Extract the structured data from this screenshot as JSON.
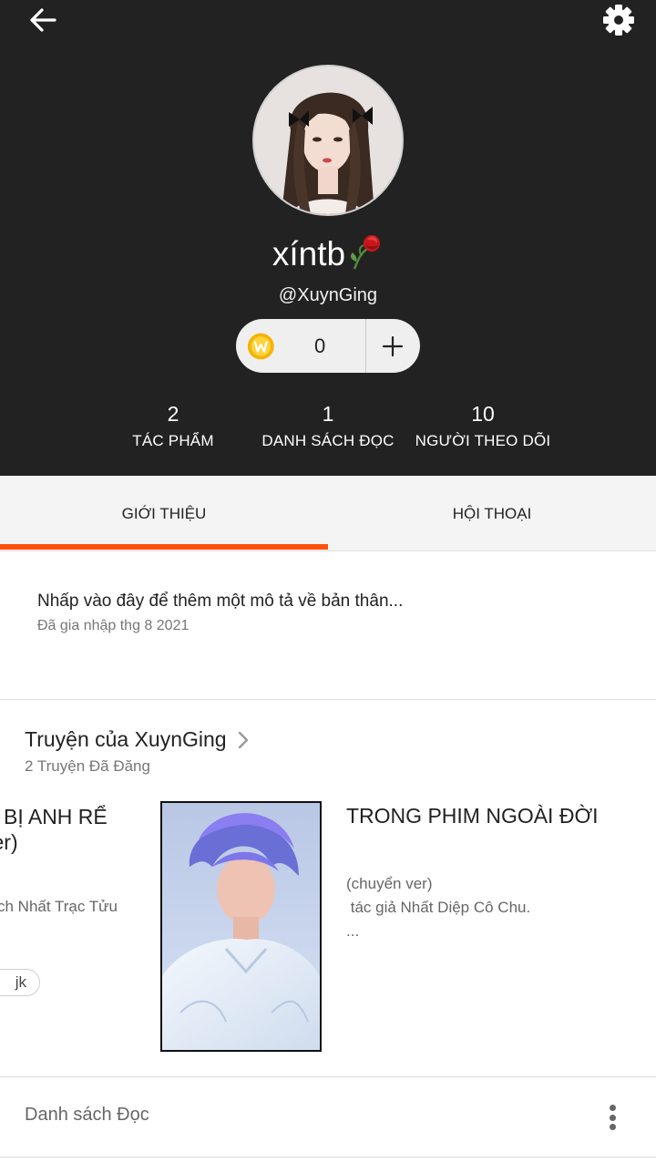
{
  "header": {
    "display_name": "xíntb",
    "username": "@XuynGing",
    "coins": {
      "count": "0",
      "icon": "wattpad-coin-icon",
      "add_icon": "plus-icon"
    },
    "stats": [
      {
        "value": "2",
        "label": "TÁC PHẨM"
      },
      {
        "value": "1",
        "label": "DANH SÁCH ĐỌC"
      },
      {
        "value": "10",
        "label": "NGƯỜI THEO DÕI"
      }
    ]
  },
  "tabs": [
    {
      "label": "GIỚI THIỆU",
      "active": true
    },
    {
      "label": "HỘI THOẠI",
      "active": false
    }
  ],
  "about": {
    "description": "Nhấp vào đây để thêm một mô tả về bản thân...",
    "joined": "Đã gia nhập thg 8 2021"
  },
  "stories": {
    "title": "Truyện của XuynGing",
    "count": "2 Truyện Đã Đăng",
    "items": [
      {
        "title_line1": "BỊ ANH RỂ",
        "title_line2": "ver)",
        "author": "ch Nhất Trạc Tửu",
        "tag": "jk"
      },
      {
        "title": "TRONG PHIM NGOÀI ĐỜI",
        "description": "(chuyển ver)\n tác giả Nhất Diệp Cô Chu.\n..."
      }
    ]
  },
  "reading_list": {
    "label": "Danh sách Đọc"
  },
  "colors": {
    "header_bg": "#222222",
    "accent": "#ff500a",
    "tab_bg": "#f4f4f4"
  }
}
